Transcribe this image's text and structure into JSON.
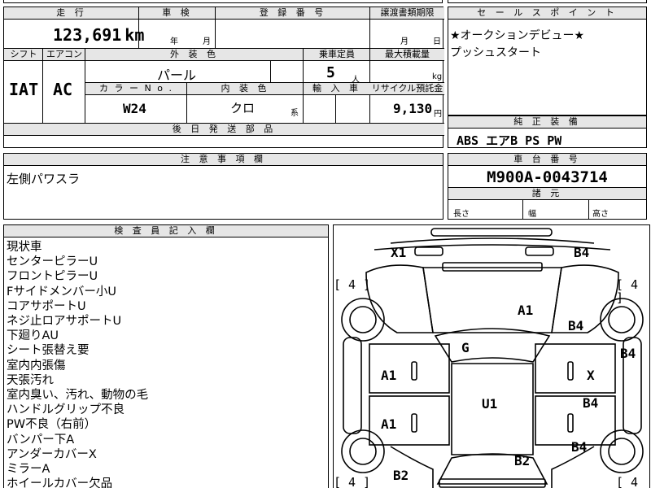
{
  "top_strip": {
    "partial_text": ""
  },
  "mileage": {
    "header": "走 行",
    "value": "123,691",
    "unit": "km"
  },
  "inspection": {
    "header": "車 検",
    "year_unit": "年",
    "month_unit": "月"
  },
  "registration": {
    "header": "登 録 番 号",
    "value": ""
  },
  "transfer_deadline": {
    "header": "譲渡書類期限",
    "month_unit": "月",
    "day_unit": "日"
  },
  "shift": {
    "header": "シフト",
    "value": "IAT"
  },
  "aircon": {
    "header": "エアコン",
    "value": "AC"
  },
  "exterior_color": {
    "header": "外 装 色",
    "value": "パール"
  },
  "capacity": {
    "header": "乗車定員",
    "value": "5",
    "unit": "人"
  },
  "max_load": {
    "header": "最大積載量",
    "unit": "kg"
  },
  "color_no": {
    "header": "カ ラ ー N o .",
    "value": "W24"
  },
  "interior_color": {
    "header": "内 装 色",
    "value": "クロ",
    "unit": "系"
  },
  "import": {
    "header": "輸 入 車"
  },
  "recycle": {
    "header": "リサイクル預託金",
    "value": "9,130",
    "unit": "円"
  },
  "later_parts": {
    "header": "後 日 発 送 部 品"
  },
  "sales_points": {
    "header": "セ ー ル ス ポ イ ン ト",
    "lines": [
      "★オークションデビュー★",
      "プッシュスタート"
    ]
  },
  "equipment": {
    "header": "純 正 装 備",
    "value": "ABS エアB PS PW"
  },
  "caution": {
    "header": "注 意 事 項 欄",
    "value": "左側パワスラ"
  },
  "chassis": {
    "header": "車 台 番 号",
    "value": "M900A-0043714"
  },
  "dimensions": {
    "header": "諸 元",
    "length": "長さ",
    "width": "幅",
    "height": "高さ"
  },
  "inspector": {
    "header": "検 査 員 記 入 欄",
    "notes": [
      "現状車",
      "センターピラーU",
      "フロントピラーU",
      "Fサイドメンバー小U",
      "コアサポートU",
      "ネジ止ロアサポートU",
      "下廻りAU",
      "シート張替え要",
      "室内内張傷",
      "天張汚れ",
      "室内臭い、汚れ、動物の毛",
      "ハンドルグリップ不良",
      "PW不良（右前）",
      "バンパー下A",
      "アンダーカバーX",
      "ミラーA",
      "ホイールカバー欠品"
    ]
  },
  "diagram": {
    "labels": {
      "x1": "X1",
      "b4_top": "B4",
      "a1_hood": "A1",
      "b4_right_front": "B4",
      "b4_right_edge": "B4",
      "g_windshield": "G",
      "a1_left_front": "A1",
      "x_right_front": "X",
      "u1_roof": "U1",
      "b4_right_rear": "B4",
      "a1_left_rear": "A1",
      "b4_right_lower": "B4",
      "b2_rear": "B2",
      "b2_left_bottom": "B2"
    },
    "tyres": {
      "top_left": "[ 4 ]",
      "top_right": "[ 4 ]",
      "bottom_left": "[ 4 ]",
      "bottom_right": "[ 4"
    }
  }
}
